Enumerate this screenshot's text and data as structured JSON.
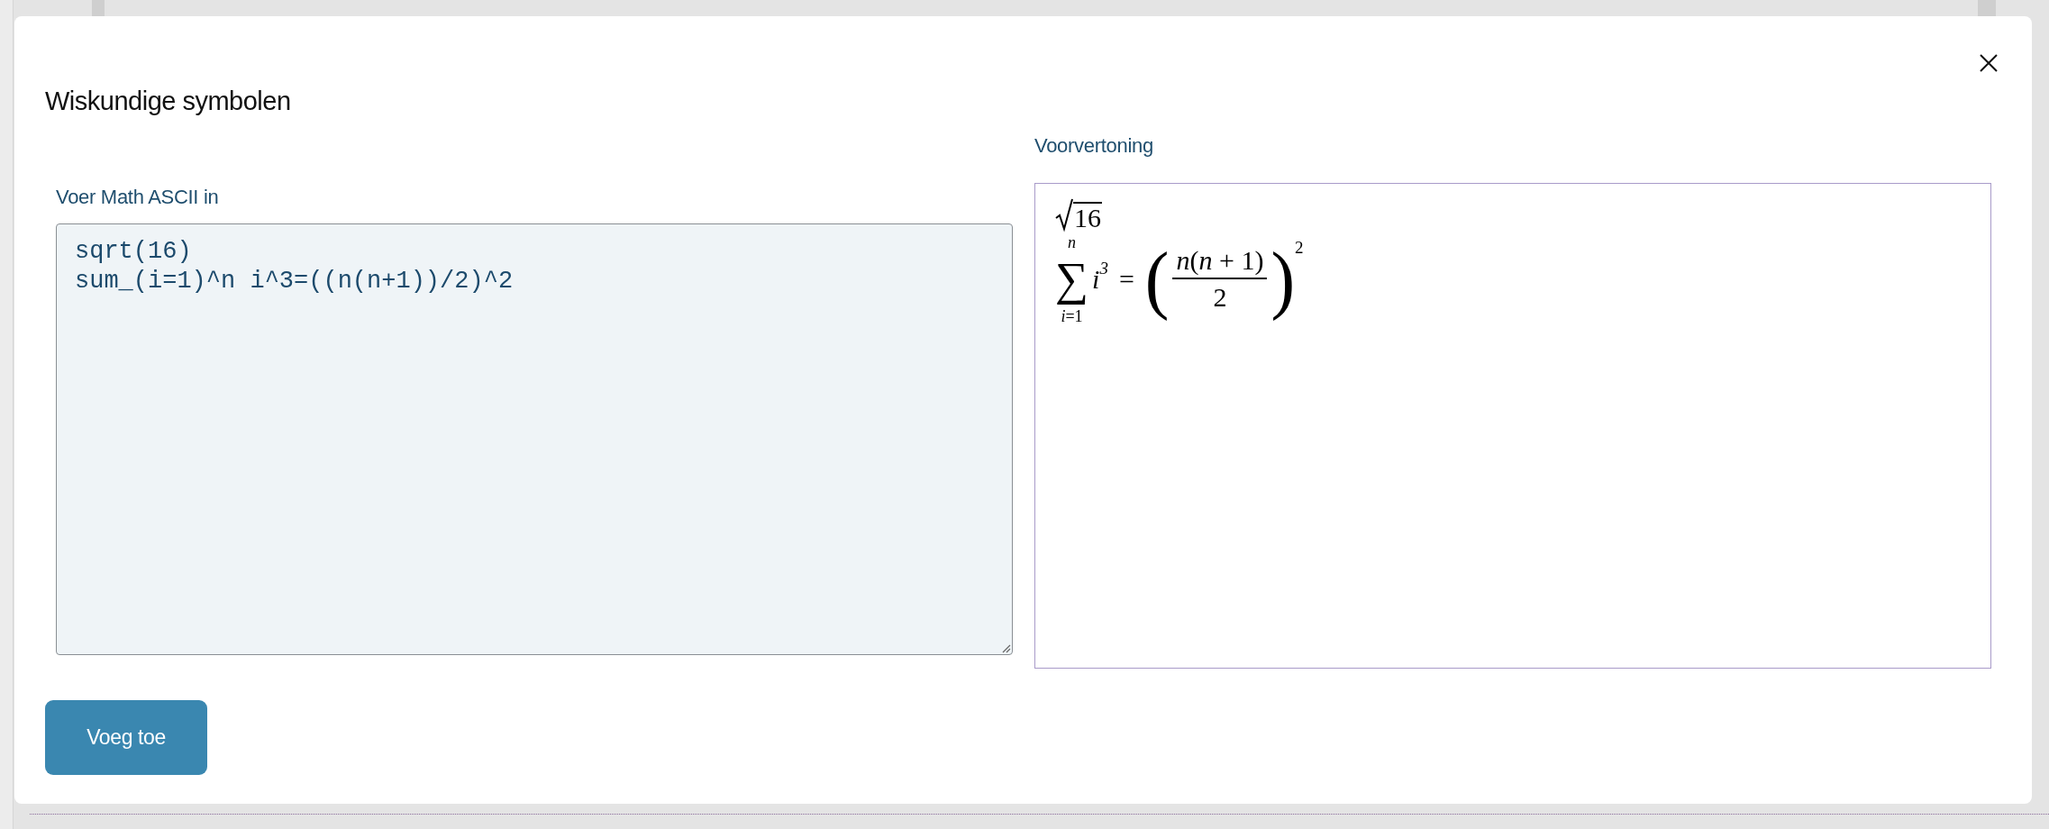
{
  "dialog": {
    "title": "Wiskundige symbolen"
  },
  "input": {
    "label": "Voer Math ASCII in",
    "value": "sqrt(16)\nsum_(i=1)^n i^3=((n(n+1))/2)^2"
  },
  "preview": {
    "label": "Voorvertoning",
    "radicand": "16",
    "sum_symbol": "∑",
    "sum_upper": "n",
    "sum_lower": "*i*=1",
    "term": "i",
    "term_exponent": "3",
    "relation": "=",
    "open_paren": "(",
    "numerator": "*n*(*n* + 1)",
    "denominator": "2",
    "close_paren": ")",
    "exponent": "2"
  },
  "buttons": [
    {
      "label": "Voeg toe"
    }
  ]
}
